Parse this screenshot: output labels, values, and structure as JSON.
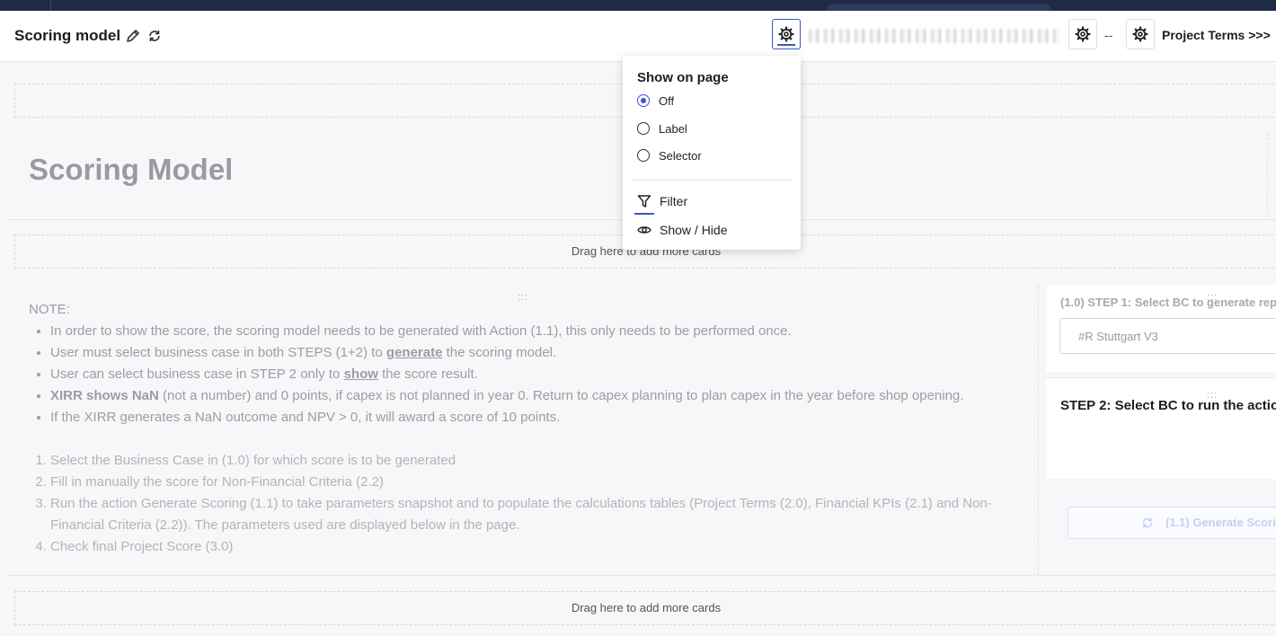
{
  "header": {
    "title": "Scoring model",
    "dash": "--",
    "project_terms": "Project Terms >>>"
  },
  "page": {
    "big_title": "Scoring Model",
    "drop_text": "Drag here to add more cards"
  },
  "note": {
    "title": "NOTE:",
    "bullets": [
      {
        "pre": "In order to show the score, the scoring model needs to be generated with Action (1.1), this only needs to be performed once.",
        "em": "",
        "post": ""
      },
      {
        "pre": "User must select business case in both STEPS (1+2) to ",
        "em": "generate",
        "post": " the scoring model."
      },
      {
        "pre": "User can select business case in STEP 2 only to ",
        "em": "show",
        "post": " the score result."
      },
      {
        "pre": "",
        "em": "XIRR shows NaN",
        "post": " (not a number) and 0 points, if capex is not planned in year 0. Return to capex planning to plan capex in the year before shop opening."
      },
      {
        "pre": "If the XIRR generates a NaN outcome and NPV > 0, it will award a score of 10 points.",
        "em": "",
        "post": ""
      }
    ],
    "steps": [
      "Select the Business Case in (1.0) for which score is to be generated",
      "Fill in manually the score for Non-Financial Criteria (2.2)",
      "Run the action Generate Scoring (1.1) to take parameters snapshot and to populate the calculations tables (Project Terms (2.0), Financial KPIs (2.1) and Non-Financial Criteria (2.2)). The parameters used are displayed below in the page.",
      "Check final Project Score (3.0)"
    ]
  },
  "right_panel": {
    "step1_label": "(1.0) STEP 1: Select BC to generate rep",
    "step1_value": "#R Stuttgart V3",
    "step2_label": "STEP 2: Select BC to run the actio",
    "generate_button": "(1.1) Generate Scori"
  },
  "popup": {
    "title": "Show on page",
    "options": [
      "Off",
      "Label",
      "Selector"
    ],
    "selected": "Off",
    "filter": "Filter",
    "show_hide": "Show / Hide"
  },
  "colors": {
    "accent": "#3a56c7",
    "topbar": "#1f2a44"
  }
}
